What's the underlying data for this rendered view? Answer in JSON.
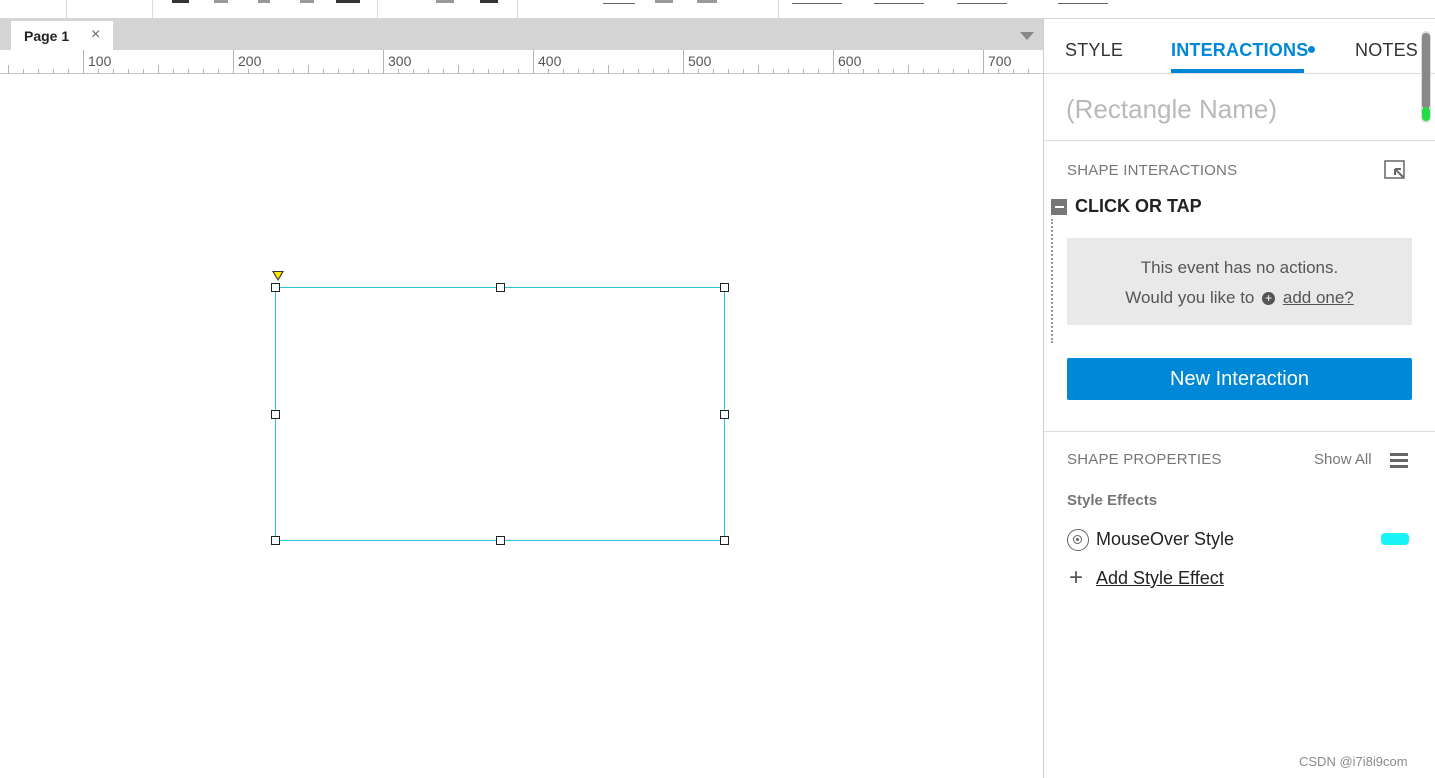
{
  "canvas": {
    "page_tab": {
      "label": "Page 1",
      "close_glyph": "×"
    },
    "ruler_labels": [
      "100",
      "200",
      "300",
      "400",
      "500",
      "600",
      "700"
    ]
  },
  "panel": {
    "tabs": {
      "style": "STYLE",
      "interactions": "INTERACTIONS",
      "notes": "NOTES"
    },
    "name_placeholder": "(Rectangle Name)",
    "shape_interactions_title": "SHAPE INTERACTIONS",
    "event_label": "CLICK OR TAP",
    "no_actions_line1": "This event has no actions.",
    "no_actions_line2_prefix": "Would you like to",
    "add_one_link": "add one?",
    "new_interaction_button": "New Interaction",
    "shape_properties_title": "SHAPE PROPERTIES",
    "show_all": "Show All",
    "style_effects_title": "Style Effects",
    "mouseover_style": "MouseOver Style",
    "mouseover_color": "#19f4f6",
    "add_style_effect": "Add Style Effect"
  },
  "colors": {
    "accent": "#0088d8",
    "shape_border": "#25c4d6"
  },
  "watermark": "CSDN @i7i8i9com"
}
